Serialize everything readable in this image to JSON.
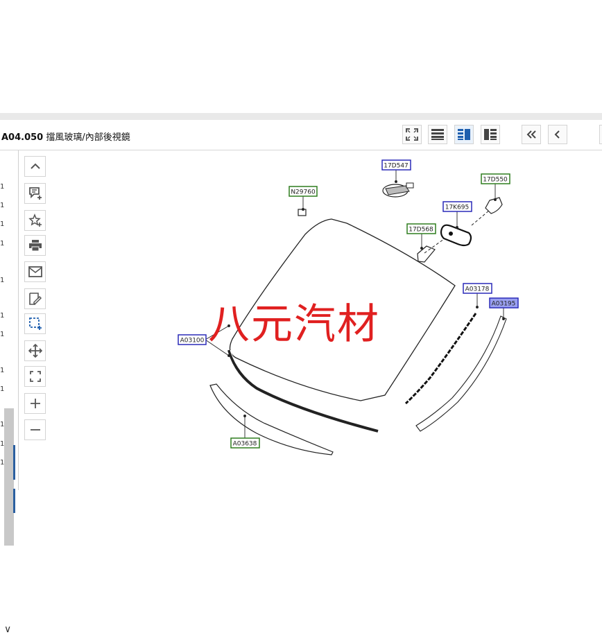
{
  "header": {
    "code": "A04.050",
    "title": "擋風玻璃/內部後視鏡"
  },
  "toolbar": {
    "buttons": [
      "fit-screen-icon",
      "list-view-icon",
      "split-view-icon",
      "side-view-icon",
      "first-page-icon",
      "previous-page-icon"
    ]
  },
  "left_list": {
    "numbers": [
      "1",
      "1",
      "1",
      "1",
      "1",
      "1",
      "1",
      "1",
      "1",
      "1",
      "1",
      "1"
    ]
  },
  "side_tools": [
    "chevron-up-icon",
    "add-note-icon",
    "favorite-add-icon",
    "print-icon",
    "mail-icon",
    "edit-note-icon",
    "select-area-icon",
    "move-icon",
    "fullscreen-icon",
    "zoom-in-icon",
    "zoom-out-icon"
  ],
  "callouts": {
    "n29760": "N29760",
    "d17d547": "17D547",
    "d17d550": "17D550",
    "k17k695": "17K695",
    "d17d568": "17D568",
    "a03178": "A03178",
    "a03195": "A03195",
    "a03100": "A03100",
    "a03638": "A03638"
  },
  "watermark": "八元汽材",
  "colors": {
    "callout_green": "#2e7d1e",
    "callout_blue": "#2a2ab8",
    "selected_fill": "#9aa0f0",
    "watermark": "#e02020"
  }
}
